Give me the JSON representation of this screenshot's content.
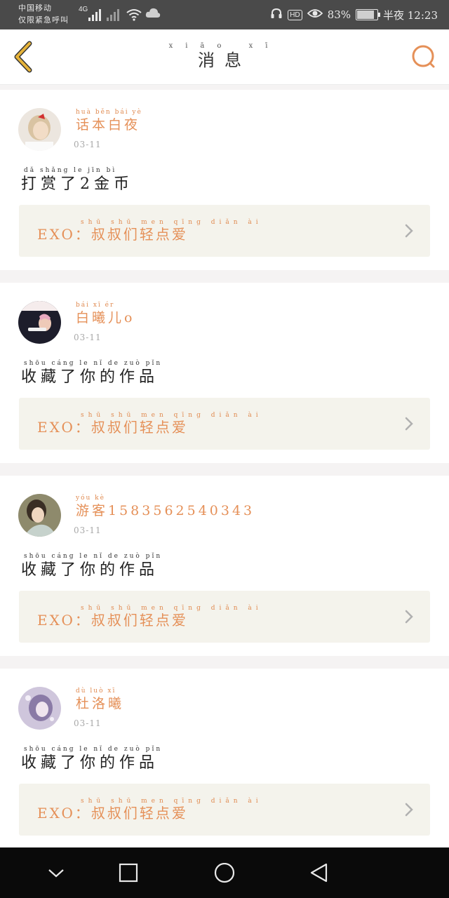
{
  "status": {
    "carrier_line1": "中国移动",
    "carrier_line2": "仅限紧急呼叫",
    "network": "4G",
    "battery": "83%",
    "time": "半夜 12:23"
  },
  "header": {
    "title": "消息",
    "title_pinyin": "xiāo xī"
  },
  "messages": [
    {
      "user": "话本白夜",
      "user_pinyin": "huà běn bái yè",
      "date": "03-11",
      "action": "打赏了2金币",
      "action_pinyin": "dǎ shǎng le jīn bì",
      "work": "EXO：叔叔们轻点爱",
      "work_pinyin": "shū shū men qīng diǎn ài"
    },
    {
      "user": "白曦儿o",
      "user_pinyin": "bái xī ér",
      "date": "03-11",
      "action": "收藏了你的作品",
      "action_pinyin": "shōu cáng le nǐ de zuò pǐn",
      "work": "EXO：叔叔们轻点爱",
      "work_pinyin": "shū shū men qīng diǎn ài"
    },
    {
      "user": "游客1583562540343",
      "user_pinyin": "yóu kè",
      "date": "03-11",
      "action": "收藏了你的作品",
      "action_pinyin": "shōu cáng le nǐ de zuò pǐn",
      "work": "EXO：叔叔们轻点爱",
      "work_pinyin": "shū shū men qīng diǎn ài"
    },
    {
      "user": "杜洛曦",
      "user_pinyin": "dù luò xī",
      "date": "03-11",
      "action": "收藏了你的作品",
      "action_pinyin": "shōu cáng le nǐ de zuò pǐn",
      "work": "EXO：叔叔们轻点爱",
      "work_pinyin": "shū shū men qīng diǎn ài"
    }
  ],
  "icons": {
    "back": "chevron-left-icon",
    "search": "search-icon",
    "row": "chevron-right-icon"
  },
  "colors": {
    "accent": "#e59058",
    "card_bg": "#f4f3ec",
    "status_bar": "#4a4a4a",
    "back_arrow": "#e6b33a"
  }
}
